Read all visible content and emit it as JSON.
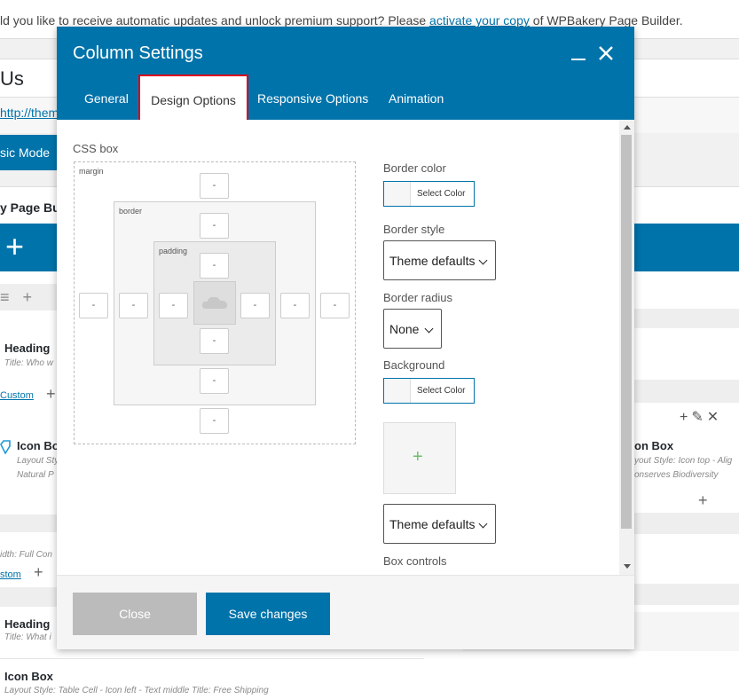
{
  "notice": {
    "before": "ld you like to receive automatic updates and unlock premium support? Please ",
    "link": "activate your copy",
    "after": " of WPBakery Page Builder."
  },
  "background": {
    "page_title": "Us",
    "url": "http://them",
    "mode_button": "sic Mode",
    "builder_label": "y Page Buil",
    "left_col": [
      {
        "name": "Heading",
        "sub": "Title: Who w"
      },
      {
        "link": "Custom"
      },
      {
        "name": "Icon Box",
        "sub": "Layout Styl",
        "sub2": "Natural P"
      },
      {
        "sub": "idth: Full  Con"
      },
      {
        "link": "stom"
      },
      {
        "name": "Heading",
        "sub": "Title: What i"
      },
      {
        "name": "Icon Box",
        "sub": "Layout Style: Table Cell - Icon left - Text middle  Title: Free Shipping"
      }
    ],
    "right_col": {
      "name": "on Box",
      "sub": "yout Style: Icon top - Alig",
      "sub2": "onserves Biodiversity"
    }
  },
  "modal": {
    "title": "Column Settings",
    "tabs": [
      "General",
      "Design Options",
      "Responsive Options",
      "Animation"
    ],
    "active_tab": "Design Options",
    "css_box": {
      "label": "CSS box",
      "margin_label": "margin",
      "border_label": "border",
      "padding_label": "padding",
      "placeholder": "-"
    },
    "border_color": {
      "label": "Border color",
      "button": "Select Color"
    },
    "border_style": {
      "label": "Border style",
      "value": "Theme defaults"
    },
    "border_radius": {
      "label": "Border radius",
      "value": "None"
    },
    "background": {
      "label": "Background",
      "button": "Select Color"
    },
    "background_style": {
      "value": "Theme defaults"
    },
    "box_controls": {
      "label": "Box controls"
    },
    "footer": {
      "close": "Close",
      "save": "Save changes"
    }
  },
  "colors": {
    "accent": "#0073aa",
    "highlight": "#d9001b",
    "close_btn": "#bbbbbb"
  }
}
